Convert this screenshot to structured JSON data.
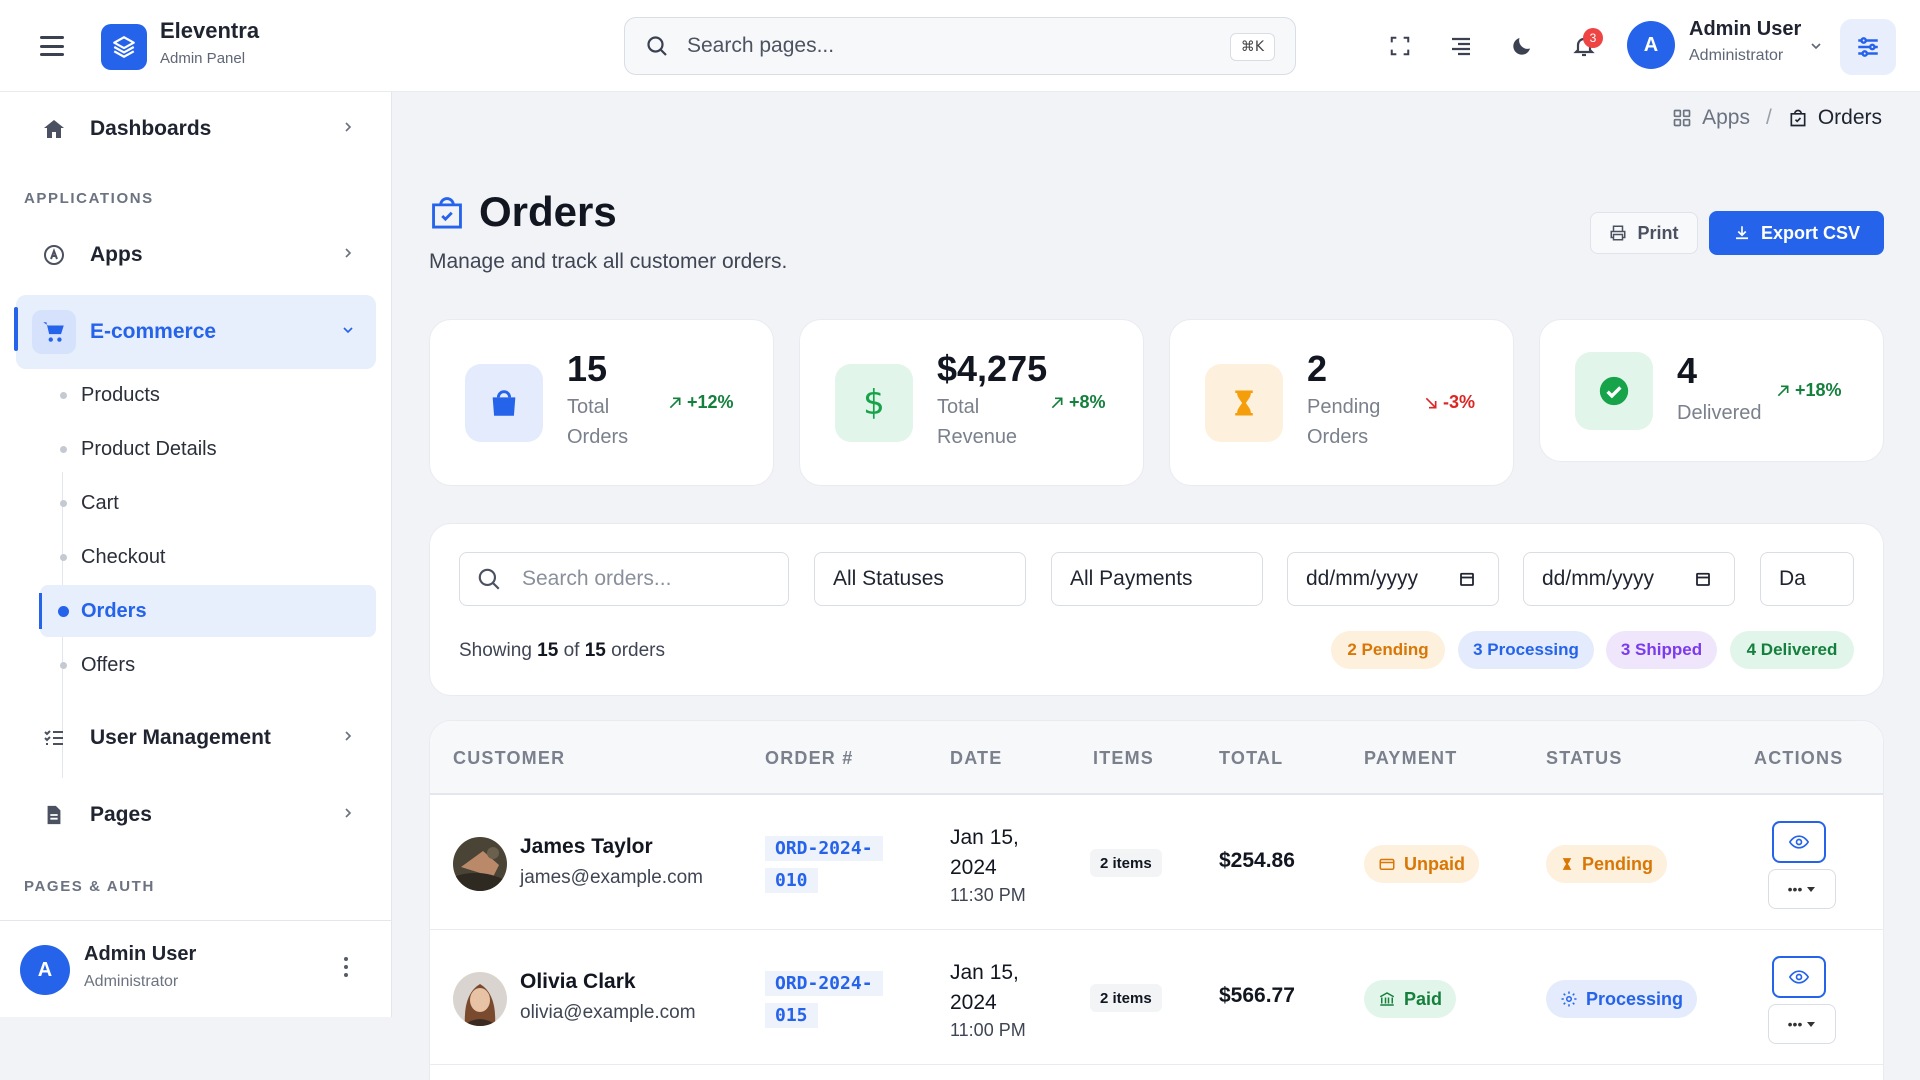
{
  "header": {
    "brand_name": "Eleventra",
    "brand_sub": "Admin Panel",
    "search_placeholder": "Search pages...",
    "search_shortcut": "⌘K",
    "notification_count": "3",
    "user_initial": "A",
    "user_name": "Admin User",
    "user_role": "Administrator"
  },
  "sidebar": {
    "dashboards": "Dashboards",
    "section_applications": "APPLICATIONS",
    "apps": "Apps",
    "ecommerce": "E-commerce",
    "sub_items": [
      "Products",
      "Product Details",
      "Cart",
      "Checkout",
      "Orders",
      "Offers"
    ],
    "user_management": "User Management",
    "pages": "Pages",
    "section_pages_auth": "PAGES & AUTH",
    "user_initial": "A",
    "user_name": "Admin User",
    "user_role": "Administrator"
  },
  "breadcrumb": {
    "parent": "Apps",
    "current": "Orders"
  },
  "page": {
    "title": "Orders",
    "subtitle": "Manage and track all customer orders.",
    "print_label": "Print",
    "export_label": "Export CSV"
  },
  "stats": [
    {
      "value": "15",
      "label_line1": "Total",
      "label_line2": "Orders",
      "trend": "+12%",
      "direction": "up",
      "color": "#2563eb"
    },
    {
      "value": "$4,275",
      "label_line1": "Total",
      "label_line2": "Revenue",
      "trend": "+8%",
      "direction": "up",
      "color": "#16a34a"
    },
    {
      "value": "2",
      "label_line1": "Pending",
      "label_line2": "Orders",
      "trend": "-3%",
      "direction": "down",
      "color": "#f59e0b"
    },
    {
      "value": "4",
      "label_line1": "Delivered",
      "label_line2": "",
      "trend": "+18%",
      "direction": "up",
      "color": "#16a34a"
    }
  ],
  "filters": {
    "search_placeholder": "Search orders...",
    "status": "All Statuses",
    "payment": "All Payments",
    "date_from": "dd/mm/yyyy",
    "date_to": "dd/mm/yyyy",
    "extra": "Da",
    "showing_prefix": "Showing",
    "showing_count": "15",
    "showing_of": "of",
    "showing_total": "15",
    "showing_suffix": "orders",
    "pills": [
      "2 Pending",
      "3 Processing",
      "3 Shipped",
      "4 Delivered"
    ]
  },
  "table": {
    "headers": [
      "CUSTOMER",
      "ORDER #",
      "DATE",
      "ITEMS",
      "TOTAL",
      "PAYMENT",
      "STATUS",
      "ACTIONS"
    ],
    "rows": [
      {
        "name": "James Taylor",
        "email": "james@example.com",
        "order_line1": "ORD-2024-",
        "order_line2": "010",
        "date_line1": "Jan 15,",
        "date_line2": "2024",
        "time": "11:30 PM",
        "items": "2 items",
        "total": "$254.86",
        "payment": "Unpaid",
        "status": "Pending"
      },
      {
        "name": "Olivia Clark",
        "email": "olivia@example.com",
        "order_line1": "ORD-2024-",
        "order_line2": "015",
        "date_line1": "Jan 15,",
        "date_line2": "2024",
        "time": "11:00 PM",
        "items": "2 items",
        "total": "$566.77",
        "payment": "Paid",
        "status": "Processing"
      }
    ]
  }
}
